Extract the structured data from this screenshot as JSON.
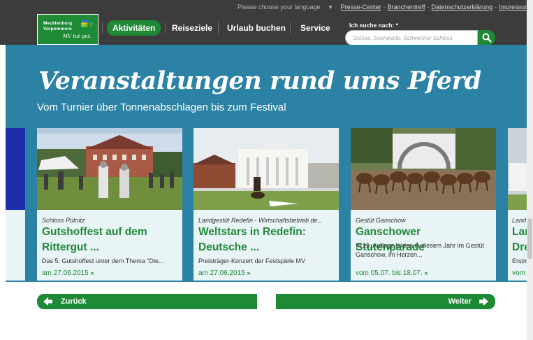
{
  "header": {
    "language_prompt": "Please choose your language",
    "utility_links": [
      "Presse-Center",
      "Branchentreff",
      "Datenschutzerklärung",
      "Impressum"
    ],
    "utility_separator": "-",
    "logo": {
      "line1": "Mecklenburg",
      "line2": "Vorpommern",
      "slogan": "MV tut gut."
    },
    "nav": [
      "Aktivitäten",
      "Reiseziele",
      "Urlaub buchen",
      "Service"
    ],
    "active_nav": "Aktivitäten",
    "search": {
      "label": "Ich suche nach: *",
      "placeholder": "Ostsee, Seenplatte, Schweriner Schloss"
    }
  },
  "hero": {
    "title": "Veranstaltungen rund ums Pferd",
    "subtitle": "Vom Turnier über Tonnenabschlagen bis zum Festival"
  },
  "cards": [
    {
      "category": "Schloss Pütnitz",
      "title": "Gutshoffest auf dem Rittergut ...",
      "description": "Das 5. Gutshoffest unter dem Thema \"Die...",
      "date": "am 27.06.2015",
      "arrow": "»"
    },
    {
      "category": "Landgestüt Redefin - Wirtschaftsbetrieb de...",
      "title": "Weltstars in Redefin: Deutsche ...",
      "description": "Preisträger-Konzert der Festspiele MV",
      "date": "am 27.06.2015",
      "arrow": "»"
    },
    {
      "category": "Gestüt Ganschow",
      "title": "Ganschower Stutenparade",
      "description": "In 19. Auflage finden in diesem Jahr im Gestüt Ganschow, im Herzen...",
      "date": "vom 05.07. bis 18.07.",
      "arrow": "»"
    }
  ],
  "partial_card": {
    "category": "Land",
    "title_line1": "Lan",
    "title_line2": "Dre",
    "description": "Erstm",
    "date": "vom"
  },
  "pager": {
    "prev_label": "Zurück",
    "next_label": "Weiter"
  },
  "colors": {
    "brand_green": "#1f8a35",
    "hero_blue": "#2c82a4",
    "header_dark": "#3c3c3c",
    "card_bg": "#e9f4f7"
  }
}
